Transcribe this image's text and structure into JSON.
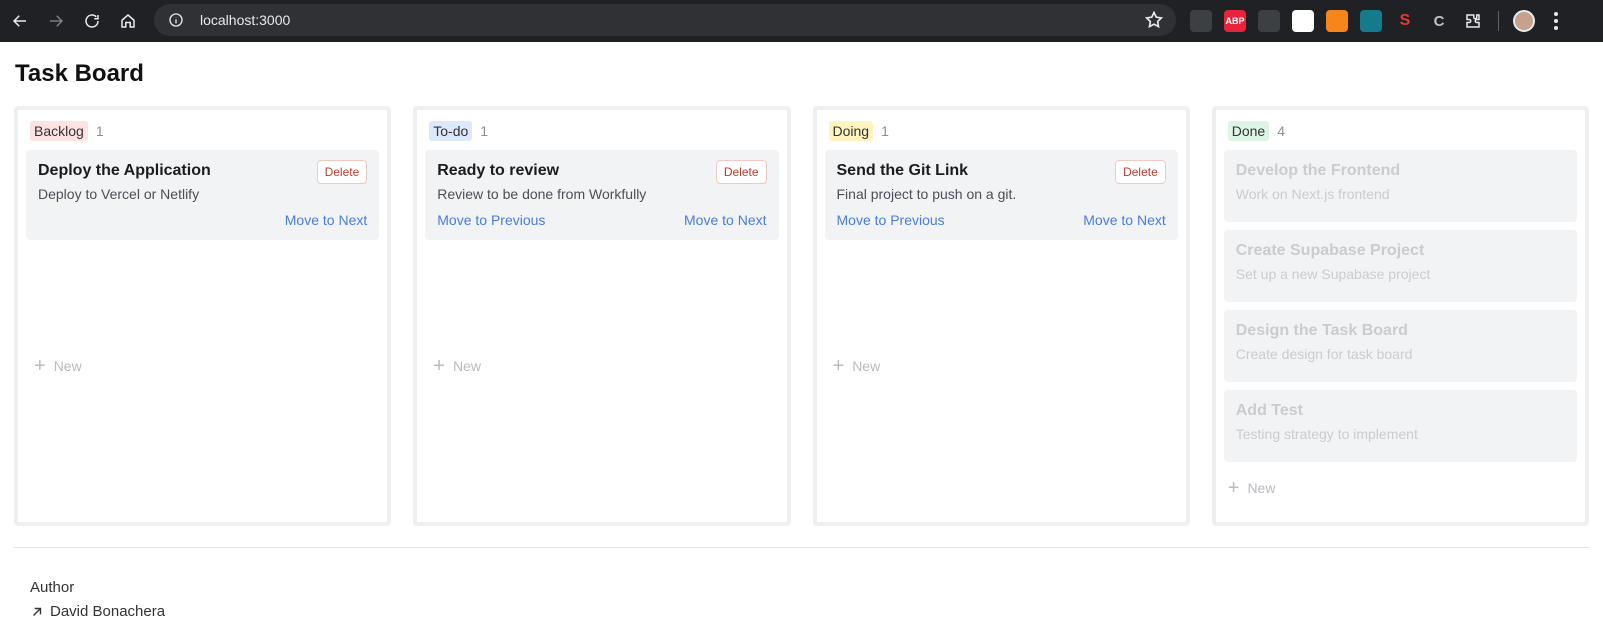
{
  "browser": {
    "url": "localhost:3000",
    "extensions": [
      {
        "name": "cloud-ext-icon",
        "label": "",
        "bg": "#3c4043"
      },
      {
        "name": "adblock-plus-icon",
        "label": "ABP",
        "bg": "#e8233c"
      },
      {
        "name": "glasses-ext-icon",
        "label": "",
        "bg": "#3c4043"
      },
      {
        "name": "eyes-ext-icon",
        "label": "",
        "bg": "#ffffff"
      },
      {
        "name": "metamask-icon",
        "label": "",
        "bg": "#f6851b"
      },
      {
        "name": "teal-ext-icon",
        "label": "",
        "bg": "#137b8c"
      },
      {
        "name": "red-s-ext-icon",
        "label": "S",
        "bg": "#202124"
      },
      {
        "name": "c-ext-icon",
        "label": "C",
        "bg": "#202124"
      },
      {
        "name": "puzzle-extensions-icon",
        "label": "",
        "bg": "#202124"
      }
    ]
  },
  "page": {
    "title": "Task Board"
  },
  "columns": [
    {
      "name": "Backlog",
      "count": "1",
      "badge_bg": "#fde2e2",
      "badge_color": "#333",
      "cards": [
        {
          "title": "Deploy the Application",
          "desc": "Deploy to Vercel or Netlify",
          "delete": "Delete",
          "prev": "",
          "next": "Move to Next"
        }
      ],
      "new_label": "New"
    },
    {
      "name": "To-do",
      "count": "1",
      "badge_bg": "#dce8fb",
      "badge_color": "#333",
      "cards": [
        {
          "title": "Ready to review",
          "desc": "Review to be done from Workfully",
          "delete": "Delete",
          "prev": "Move to Previous",
          "next": "Move to Next"
        }
      ],
      "new_label": "New"
    },
    {
      "name": "Doing",
      "count": "1",
      "badge_bg": "#fdf4c0",
      "badge_color": "#333",
      "cards": [
        {
          "title": "Send the Git Link",
          "desc": "Final project to push on a git.",
          "delete": "Delete",
          "prev": "Move to Previous",
          "next": "Move to Next"
        }
      ],
      "new_label": "New"
    },
    {
      "name": "Done",
      "count": "4",
      "badge_bg": "#ddf5e4",
      "badge_color": "#333",
      "cards": [
        {
          "title": "Develop the Frontend",
          "desc": "Work on Next.js frontend"
        },
        {
          "title": "Create Supabase Project",
          "desc": "Set up a new Supabase project"
        },
        {
          "title": "Design the Task Board",
          "desc": "Create design for task board"
        },
        {
          "title": "Add Test",
          "desc": "Testing strategy to implement"
        }
      ],
      "new_label": "New"
    }
  ],
  "footer": {
    "author_label": "Author",
    "author_name": "David Bonachera"
  }
}
